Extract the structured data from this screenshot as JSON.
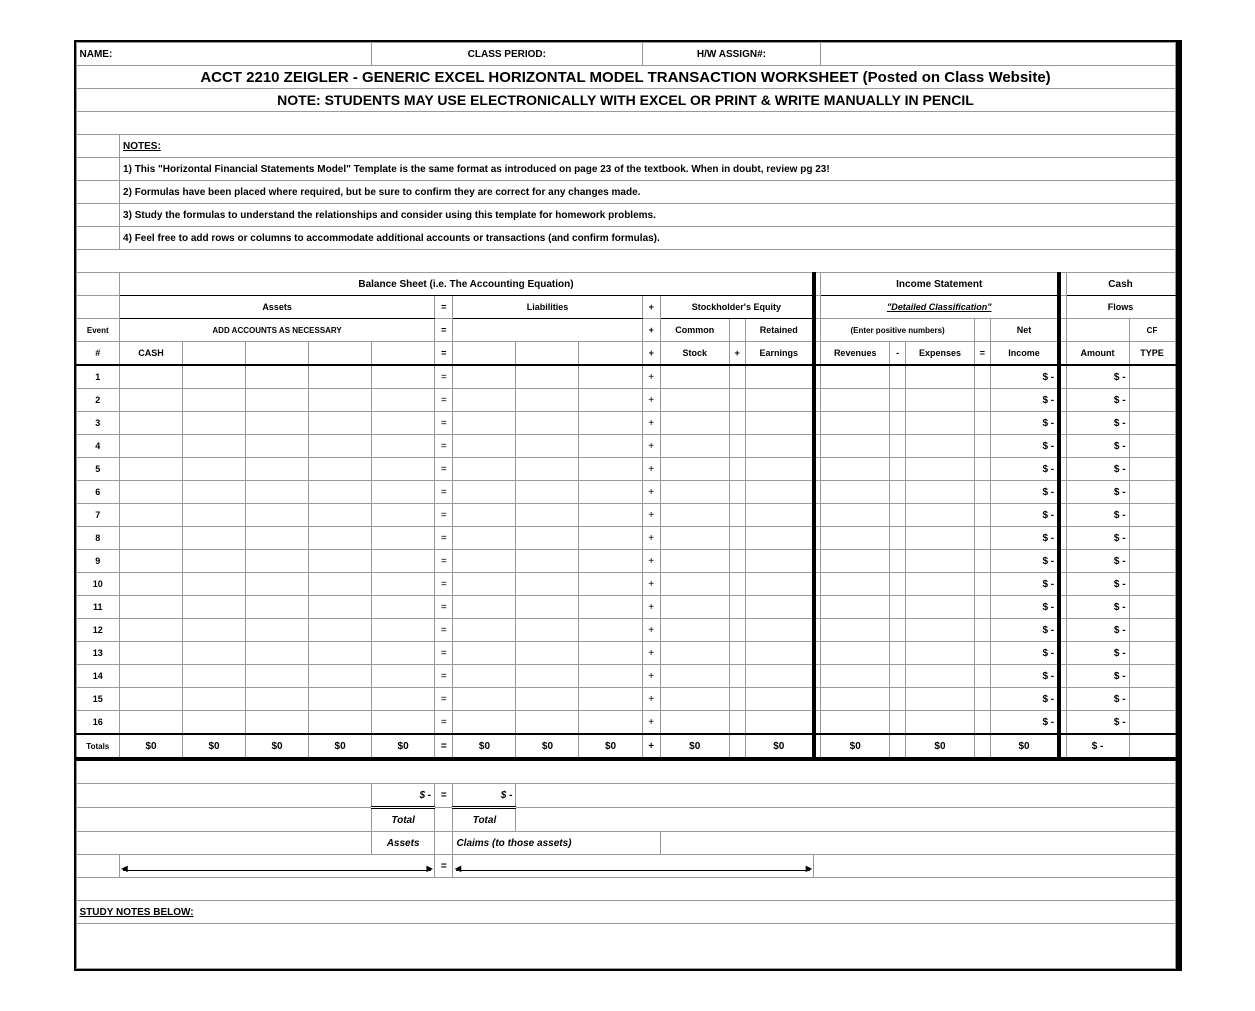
{
  "header": {
    "name_label": "NAME:",
    "class_period_label": "CLASS PERIOD:",
    "hw_assign_label": "H/W ASSIGN#:",
    "title1": "ACCT 2210 ZEIGLER - GENERIC EXCEL HORIZONTAL MODEL TRANSACTION WORKSHEET (Posted on Class Website)",
    "title2": "NOTE: STUDENTS MAY USE ELECTRONICALLY WITH EXCEL OR PRINT & WRITE MANUALLY IN PENCIL"
  },
  "notes": {
    "heading": "NOTES:",
    "items": [
      "1) This \"Horizontal Financial Statements Model\" Template is the same format as introduced on page 23 of the textbook. When in doubt, review pg 23!",
      "2) Formulas have been placed where required, but be sure to confirm they are correct for any changes made.",
      "3) Study the formulas to understand the relationships and consider using this template for homework problems.",
      "4) Feel free to add rows or columns to accommodate additional accounts or transactions (and confirm formulas)."
    ]
  },
  "sections": {
    "balance_sheet": "Balance Sheet (i.e. The Accounting Equation)",
    "income_statement": "Income Statement",
    "cash": "Cash",
    "assets": "Assets",
    "eq": "=",
    "liabilities": "Liabilities",
    "plus": "+",
    "stockholders_equity": "Stockholder's Equity",
    "detailed_classification": "\"Detailed Classification\"",
    "flows": "Flows",
    "event": "Event",
    "add_accounts": "ADD ACCOUNTS AS NECESSARY",
    "common": "Common",
    "retained": "Retained",
    "enter_positive": "(Enter positive numbers)",
    "net": "Net",
    "hash": "#",
    "cash_col": "CASH",
    "stock": "Stock",
    "plus2": "+",
    "earnings": "Earnings",
    "revenues": "Revenues",
    "minus": "-",
    "expenses": "Expenses",
    "eq2": "=",
    "income": "Income",
    "amount": "Amount",
    "type": "TYPE",
    "cf": "CF"
  },
  "rows": [
    1,
    2,
    3,
    4,
    5,
    6,
    7,
    8,
    9,
    10,
    11,
    12,
    13,
    14,
    15,
    16
  ],
  "row_income_display": "$         -",
  "row_amount_display": "$         -",
  "totals": {
    "label": "Totals",
    "zero": "$0",
    "dash": "$         -"
  },
  "footer": {
    "dollar_dash": "$         -",
    "total": "Total",
    "assets": "Assets",
    "claims": "Claims (to those assets)",
    "study_notes": "STUDY NOTES BELOW:"
  }
}
